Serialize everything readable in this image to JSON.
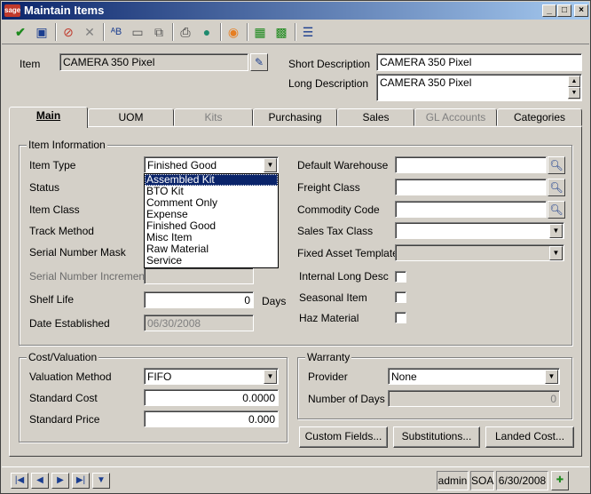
{
  "window": {
    "title": "Maintain Items",
    "logo_text": "sage",
    "controls": {
      "minimize": "_",
      "maximize": "□",
      "close": "×"
    }
  },
  "header": {
    "item_label": "Item",
    "item_value": "CAMERA 350 Pixel",
    "short_desc_label": "Short Description",
    "short_desc_value": "CAMERA 350 Pixel",
    "long_desc_label": "Long Description",
    "long_desc_value": "CAMERA 350 Pixel"
  },
  "tabs": [
    {
      "label": "Main"
    },
    {
      "label": "UOM"
    },
    {
      "label": "Kits"
    },
    {
      "label": "Purchasing"
    },
    {
      "label": "Sales"
    },
    {
      "label": "GL Accounts"
    },
    {
      "label": "Categories"
    }
  ],
  "item_info": {
    "title": "Item Information",
    "item_type_label": "Item Type",
    "item_type_value": "Finished Good",
    "status_label": "Status",
    "item_class_label": "Item Class",
    "track_method_label": "Track Method",
    "serial_mask_label": "Serial Number Mask",
    "serial_increment_label": "Serial Number Increment",
    "shelf_life_label": "Shelf Life",
    "shelf_life_value": "0",
    "shelf_life_unit": "Days",
    "date_established_label": "Date Established",
    "date_established_value": "06/30/2008",
    "default_warehouse_label": "Default Warehouse",
    "freight_class_label": "Freight Class",
    "commodity_code_label": "Commodity Code",
    "sales_tax_class_label": "Sales Tax Class",
    "fixed_asset_label": "Fixed Asset Template",
    "internal_long_desc_label": "Internal Long Desc",
    "seasonal_item_label": "Seasonal Item",
    "haz_material_label": "Haz Material"
  },
  "item_type_dropdown": {
    "options": [
      "Assembled Kit",
      "BTO Kit",
      "Comment Only",
      "Expense",
      "Finished Good",
      "Misc Item",
      "Raw Material",
      "Service"
    ],
    "highlighted": "Assembled Kit"
  },
  "cost": {
    "title": "Cost/Valuation",
    "method_label": "Valuation Method",
    "method_value": "FIFO",
    "std_cost_label": "Standard Cost",
    "std_cost_value": "0.0000",
    "std_price_label": "Standard Price",
    "std_price_value": "0.000"
  },
  "warranty": {
    "title": "Warranty",
    "provider_label": "Provider",
    "provider_value": "None",
    "days_label": "Number of Days",
    "days_value": "0"
  },
  "buttons": {
    "custom_fields": "Custom Fields...",
    "substitutions": "Substitutions...",
    "landed_cost": "Landed Cost..."
  },
  "statusbar": {
    "user": "admin",
    "company": "SOA",
    "date": "6/30/2008"
  },
  "colors": {
    "title_start": "#0a246a",
    "title_end": "#a6caf0",
    "face": "#d4d0c8",
    "selection": "#0a246a"
  }
}
